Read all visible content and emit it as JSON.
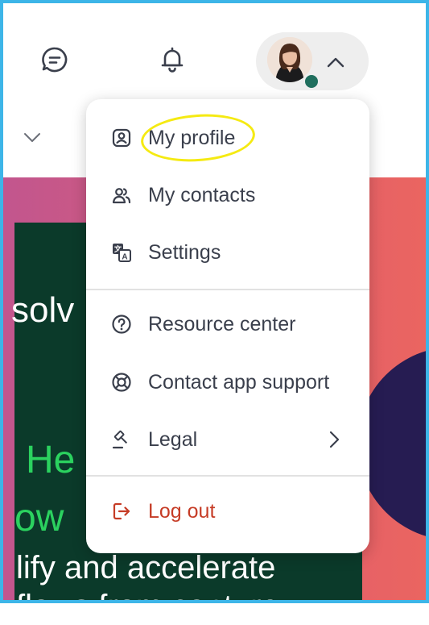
{
  "header": {
    "chat_icon": "chat-bubble-icon",
    "notifications_icon": "bell-icon",
    "account": {
      "avatar": "user-avatar",
      "status_color": "#1f6e5d",
      "toggle_icon": "chevron-up-icon"
    }
  },
  "account_menu": {
    "items": [
      {
        "label": "My profile",
        "icon": "user-badge-icon"
      },
      {
        "label": "My contacts",
        "icon": "contacts-icon"
      },
      {
        "label": "Settings",
        "icon": "translate-icon"
      },
      {
        "label": "Resource center",
        "icon": "question-circle-icon"
      },
      {
        "label": "Contact app support",
        "icon": "lifebuoy-icon"
      },
      {
        "label": "Legal",
        "icon": "gavel-icon",
        "has_submenu": true
      },
      {
        "label": "Log out",
        "icon": "logout-icon",
        "color": "#c63c26"
      }
    ],
    "highlight_color": "#f5ea12"
  },
  "background": {
    "hero_lines": [
      "solv",
      "He",
      "ow",
      "lify and accelerate",
      "flows from capture"
    ],
    "colors": {
      "panel": "#0b3a2a",
      "accent_text": "#2bd25f",
      "frame_border": "#3db5e8"
    }
  }
}
